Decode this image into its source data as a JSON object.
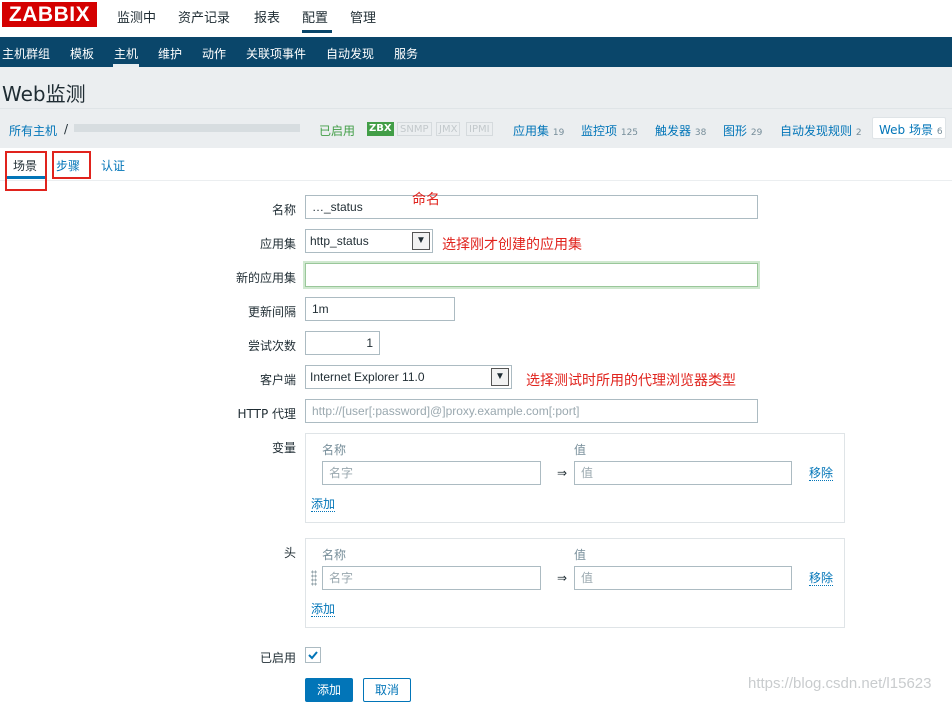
{
  "logo": "ZABBIX",
  "top_menu": [
    "监测中",
    "资产记录",
    "报表",
    "配置",
    "管理"
  ],
  "sub_menu": [
    "主机群组",
    "模板",
    "主机",
    "维护",
    "动作",
    "关联项事件",
    "自动发现",
    "服务"
  ],
  "page_title": "Web监测",
  "breadcrumb": {
    "all_hosts": "所有主机",
    "separator": "/",
    "status": "已启用",
    "protocols": [
      "ZBX",
      "SNMP",
      "JMX",
      "IPMI"
    ],
    "items": [
      {
        "label": "应用集",
        "count": "19"
      },
      {
        "label": "监控项",
        "count": "125"
      },
      {
        "label": "触发器",
        "count": "38"
      },
      {
        "label": "图形",
        "count": "29"
      },
      {
        "label": "自动发现规则",
        "count": "2"
      },
      {
        "label": "Web 场景",
        "count": "6"
      }
    ]
  },
  "tabs": [
    "场景",
    "步骤",
    "认证"
  ],
  "form": {
    "name_label": "名称",
    "name_value": "…_status",
    "application_label": "应用集",
    "application_value": "http_status",
    "new_application_label": "新的应用集",
    "new_application_value": "",
    "update_interval_label": "更新间隔",
    "update_interval_value": "1m",
    "attempts_label": "尝试次数",
    "attempts_value": "1",
    "agent_label": "客户端",
    "agent_value": "Internet Explorer 11.0",
    "proxy_label": "HTTP 代理",
    "proxy_placeholder": "http://[user[:password]@]proxy.example.com[:port]",
    "variables_label": "变量",
    "headers_label": "头",
    "col_name": "名称",
    "col_value": "值",
    "name_placeholder": "名字",
    "value_placeholder": "值",
    "arrow": "⇒",
    "remove": "移除",
    "add_link": "添加",
    "enabled_label": "已启用",
    "enabled_checked": true,
    "add_button": "添加",
    "cancel_button": "取消"
  },
  "annotations": {
    "name_note": "命名",
    "application_note": "选择刚才创建的应用集",
    "agent_note": "选择测试时所用的代理浏览器类型"
  },
  "watermark": "https://blog.csdn.net/l15623",
  "colors": {
    "brand_red": "#d40000",
    "nav_blue": "#0a466a",
    "link_blue": "#0275b8",
    "enabled_green": "#429e47",
    "annotation_red": "#e0231d",
    "button_blue": "#0275b8"
  }
}
